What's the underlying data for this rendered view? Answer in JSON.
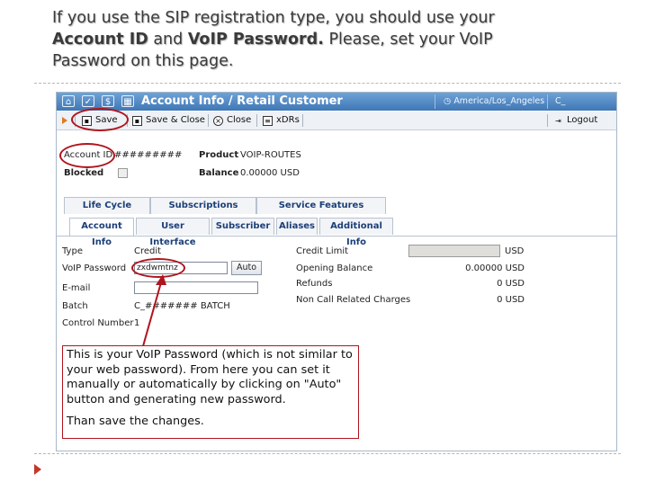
{
  "slide": {
    "line1": "If you use the SIP registration type, you should use your",
    "kw_account_id": "Account ID",
    "word_and": "and",
    "kw_voip_password": "VoIP Password.",
    "line2_rest": "Please,  set your  VoIP",
    "line3": "Password on this page."
  },
  "window": {
    "title": "Account Info / Retail Customer",
    "timezone": "America/Los_Angeles",
    "user": "C_"
  },
  "toolbar": {
    "save": "Save",
    "save_close": "Save & Close",
    "close": "Close",
    "xdrs": "xDRs",
    "logout": "Logout"
  },
  "header_fields": {
    "account_id_label": "Account ID",
    "account_id_value": "#########",
    "blocked_label": "Blocked",
    "product_label": "Product",
    "product_value": "VOIP-ROUTES",
    "balance_label": "Balance",
    "balance_value": "0.00000 USD"
  },
  "tabs_row1": [
    "Life Cycle",
    "Subscriptions",
    "Service Features"
  ],
  "tabs_row2": [
    "Account Info",
    "User Interface",
    "Subscriber",
    "Aliases",
    "Additional Info"
  ],
  "form": {
    "type_label": "Type",
    "type_value": "Credit",
    "voip_password_label": "VoIP Password",
    "voip_password_value": "zxdwmtnz",
    "auto_button": "Auto",
    "email_label": "E-mail",
    "email_value": "",
    "batch_label": "Batch",
    "batch_value": "C_####### BATCH",
    "control_number_label": "Control Number",
    "control_number_value": "1"
  },
  "right_panel": {
    "credit_limit_label": "Credit Limit",
    "credit_limit_currency": "USD",
    "opening_balance_label": "Opening Balance",
    "opening_balance_value": "0.00000 USD",
    "refunds_label": "Refunds",
    "refunds_value": "0 USD",
    "non_call_label": "Non Call Related Charges",
    "non_call_value": "0 USD"
  },
  "callout": {
    "p1": "This is your VoIP Password (which is not similar to your web password). From here you can set it manually or automatically by clicking on \"Auto\" button and generating new password.",
    "p2": "Than save the changes."
  },
  "colors": {
    "annotation_red": "#b0141d",
    "titlebar_blue": "#3f77b6",
    "tab_text": "#1c3f78"
  }
}
